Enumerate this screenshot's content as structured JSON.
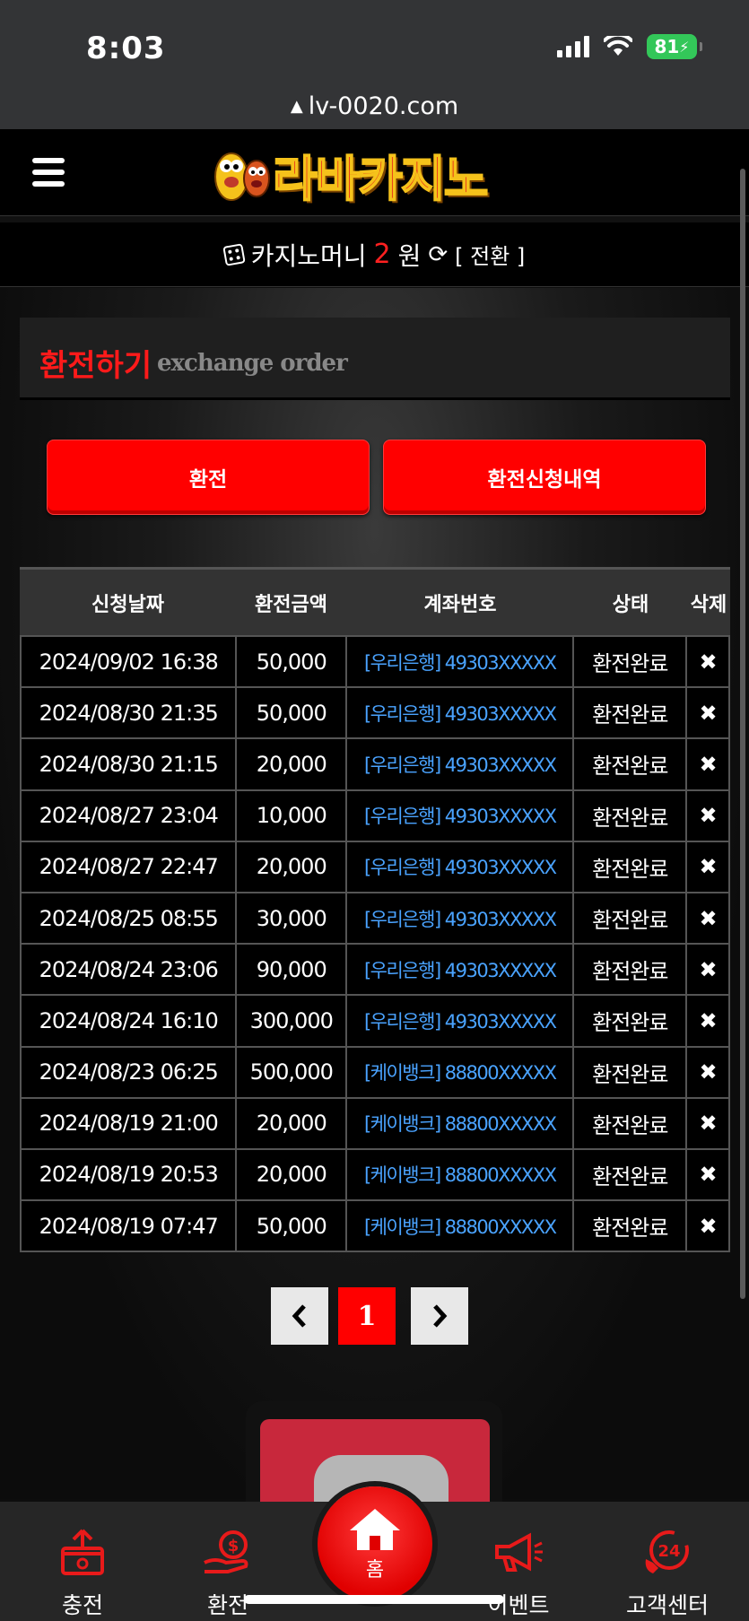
{
  "status_bar": {
    "time": "8:03",
    "battery": "81"
  },
  "url_bar": {
    "url": "lv-0020.com"
  },
  "header": {
    "logo_text": "라바카지노"
  },
  "money_bar": {
    "label": "카지노머니",
    "amount": "2",
    "unit": "원",
    "switch_label": "[ 전환 ]"
  },
  "page_title": {
    "korean": "환전하기",
    "english": "exchange order"
  },
  "buttons": {
    "exchange": "환전",
    "history": "환전신청내역"
  },
  "table": {
    "headers": [
      "신청날짜",
      "환전금액",
      "계좌번호",
      "상태",
      "삭제"
    ],
    "rows": [
      {
        "date": "2024/09/02 16:38",
        "amount": "50,000",
        "account": "[우리은행] 49303XXXXX",
        "status": "환전완료"
      },
      {
        "date": "2024/08/30 21:35",
        "amount": "50,000",
        "account": "[우리은행] 49303XXXXX",
        "status": "환전완료"
      },
      {
        "date": "2024/08/30 21:15",
        "amount": "20,000",
        "account": "[우리은행] 49303XXXXX",
        "status": "환전완료"
      },
      {
        "date": "2024/08/27 23:04",
        "amount": "10,000",
        "account": "[우리은행] 49303XXXXX",
        "status": "환전완료"
      },
      {
        "date": "2024/08/27 22:47",
        "amount": "20,000",
        "account": "[우리은행] 49303XXXXX",
        "status": "환전완료"
      },
      {
        "date": "2024/08/25 08:55",
        "amount": "30,000",
        "account": "[우리은행] 49303XXXXX",
        "status": "환전완료"
      },
      {
        "date": "2024/08/24 23:06",
        "amount": "90,000",
        "account": "[우리은행] 49303XXXXX",
        "status": "환전완료"
      },
      {
        "date": "2024/08/24 16:10",
        "amount": "300,000",
        "account": "[우리은행] 49303XXXXX",
        "status": "환전완료"
      },
      {
        "date": "2024/08/23 06:25",
        "amount": "500,000",
        "account": "[케이뱅크] 88800XXXXX",
        "status": "환전완료"
      },
      {
        "date": "2024/08/19 21:00",
        "amount": "20,000",
        "account": "[케이뱅크] 88800XXXXX",
        "status": "환전완료"
      },
      {
        "date": "2024/08/19 20:53",
        "amount": "20,000",
        "account": "[케이뱅크] 88800XXXXX",
        "status": "환전완료"
      },
      {
        "date": "2024/08/19 07:47",
        "amount": "50,000",
        "account": "[케이뱅크] 88800XXXXX",
        "status": "환전완료"
      }
    ],
    "delete_icon": "✖"
  },
  "pagination": {
    "current_page": "1",
    "prev_icon": "chevron-left-icon",
    "next_icon": "chevron-right-icon"
  },
  "bottom_nav": {
    "items": [
      {
        "label": "충전",
        "icon": "deposit-icon"
      },
      {
        "label": "환전",
        "icon": "exchange-icon"
      },
      {
        "label": "홈",
        "icon": "home-icon"
      },
      {
        "label": "이벤트",
        "icon": "megaphone-icon"
      },
      {
        "label": "고객센터",
        "icon": "support-24-icon"
      }
    ]
  },
  "colors": {
    "accent": "#ff0000",
    "account_link": "#4aa3ff",
    "background": "#0d0d0d"
  }
}
